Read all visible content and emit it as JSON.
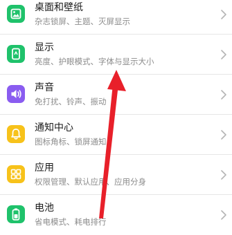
{
  "settings": {
    "items": [
      {
        "title": "桌面和壁纸",
        "subtitle": "杂志锁屏、主题、灭屏显示",
        "icon": "wallpaper-icon",
        "color": "#1fc26b"
      },
      {
        "title": "显示",
        "subtitle": "亮度、护眼模式、字体与显示大小",
        "icon": "display-icon",
        "color": "#1fc26b"
      },
      {
        "title": "声音",
        "subtitle": "免打扰、铃声、振动",
        "icon": "sound-icon",
        "color": "#8a5cf0"
      },
      {
        "title": "通知中心",
        "subtitle": "图标角标、锁屏通知",
        "icon": "notification-bell-icon",
        "color": "#f7c21a"
      },
      {
        "title": "应用",
        "subtitle": "权限管理、默认应用、应用分身",
        "icon": "apps-grid-icon",
        "color": "#f7c21a"
      },
      {
        "title": "电池",
        "subtitle": "省电模式、耗电排行",
        "icon": "battery-icon",
        "color": "#1fc26b"
      }
    ]
  },
  "annotation": {
    "arrow_color": "#e8202a"
  }
}
